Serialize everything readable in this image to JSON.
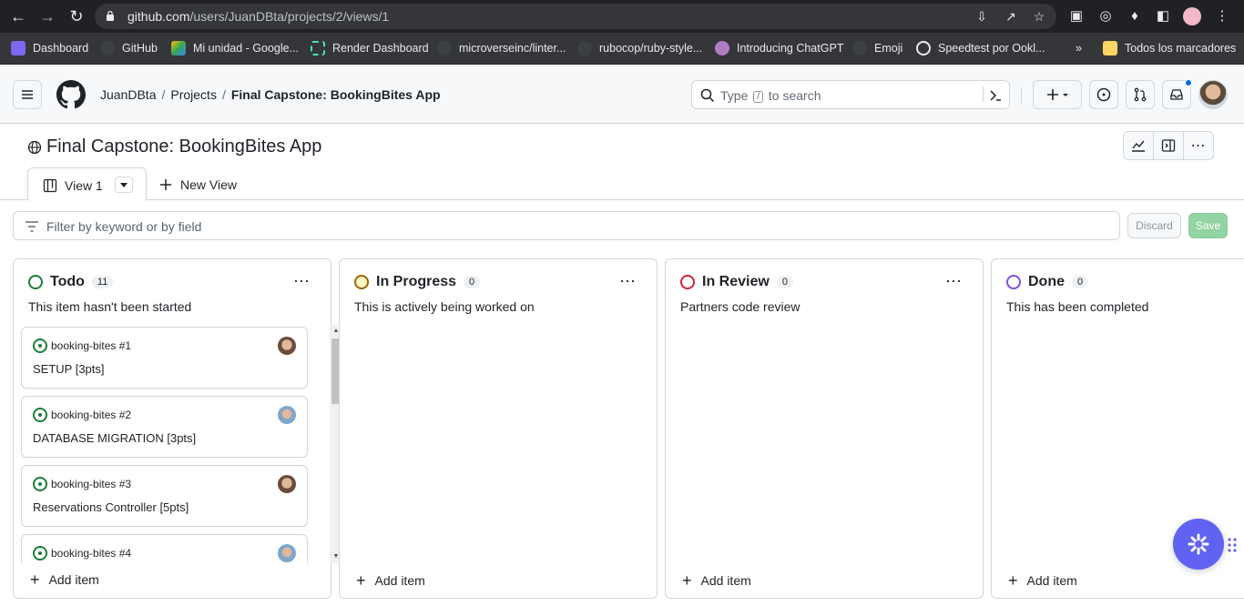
{
  "browser": {
    "url_host": "github.com",
    "url_path": "/users/JuanDBta/projects/2/views/1",
    "bookmarks": [
      {
        "label": "Dashboard",
        "color": "#7b68ee"
      },
      {
        "label": "GitHub",
        "color": "#3c4043"
      },
      {
        "label": "Mi unidad - Google...",
        "color": "#34a853"
      },
      {
        "label": "Render Dashboard",
        "color": "#46e3b7"
      },
      {
        "label": "microverseinc/linter...",
        "color": "#3c4043"
      },
      {
        "label": "rubocop/ruby-style...",
        "color": "#3c4043"
      },
      {
        "label": "Introducing ChatGPT",
        "color": "#b07cc6"
      },
      {
        "label": "Emoji",
        "color": "#3c4043"
      },
      {
        "label": "Speedtest por Ookl...",
        "color": "#202124"
      }
    ],
    "bookmarks_overflow": "»",
    "all_bookmarks": "Todos los marcadores"
  },
  "header": {
    "breadcrumb": {
      "user": "JuanDBta",
      "section": "Projects",
      "current": "Final Capstone: BookingBites App"
    },
    "search_prefix": "Type",
    "search_key": "/",
    "search_suffix": "to search"
  },
  "project": {
    "title": "Final Capstone: BookingBites App",
    "tabs": [
      {
        "label": "View 1"
      }
    ],
    "new_view_label": "New View",
    "filter_placeholder": "Filter by keyword or by field",
    "discard_label": "Discard",
    "save_label": "Save"
  },
  "columns": [
    {
      "name": "Todo",
      "count": "11",
      "description": "This item hasn't been started",
      "color": "#1a7f37",
      "add_label": "Add item"
    },
    {
      "name": "In Progress",
      "count": "0",
      "description": "This is actively being worked on",
      "color": "#9a6700",
      "add_label": "Add item"
    },
    {
      "name": "In Review",
      "count": "0",
      "description": "Partners code review",
      "color": "#cf222e",
      "add_label": "Add item"
    },
    {
      "name": "Done",
      "count": "0",
      "description": "This has been completed",
      "color": "#8250df",
      "add_label": "Add item"
    }
  ],
  "cards": [
    {
      "repo": "booking-bites #1",
      "title": "SETUP [3pts]",
      "avatar_color": "#b07a5b"
    },
    {
      "repo": "booking-bites #2",
      "title": "DATABASE MIGRATION [3pts]",
      "avatar_color": "#7fa7c9"
    },
    {
      "repo": "booking-bites #3",
      "title": "Reservations Controller [5pts]",
      "avatar_color": "#b07a5b"
    },
    {
      "repo": "booking-bites #4",
      "title": "",
      "avatar_color": "#7fa7c9"
    }
  ]
}
